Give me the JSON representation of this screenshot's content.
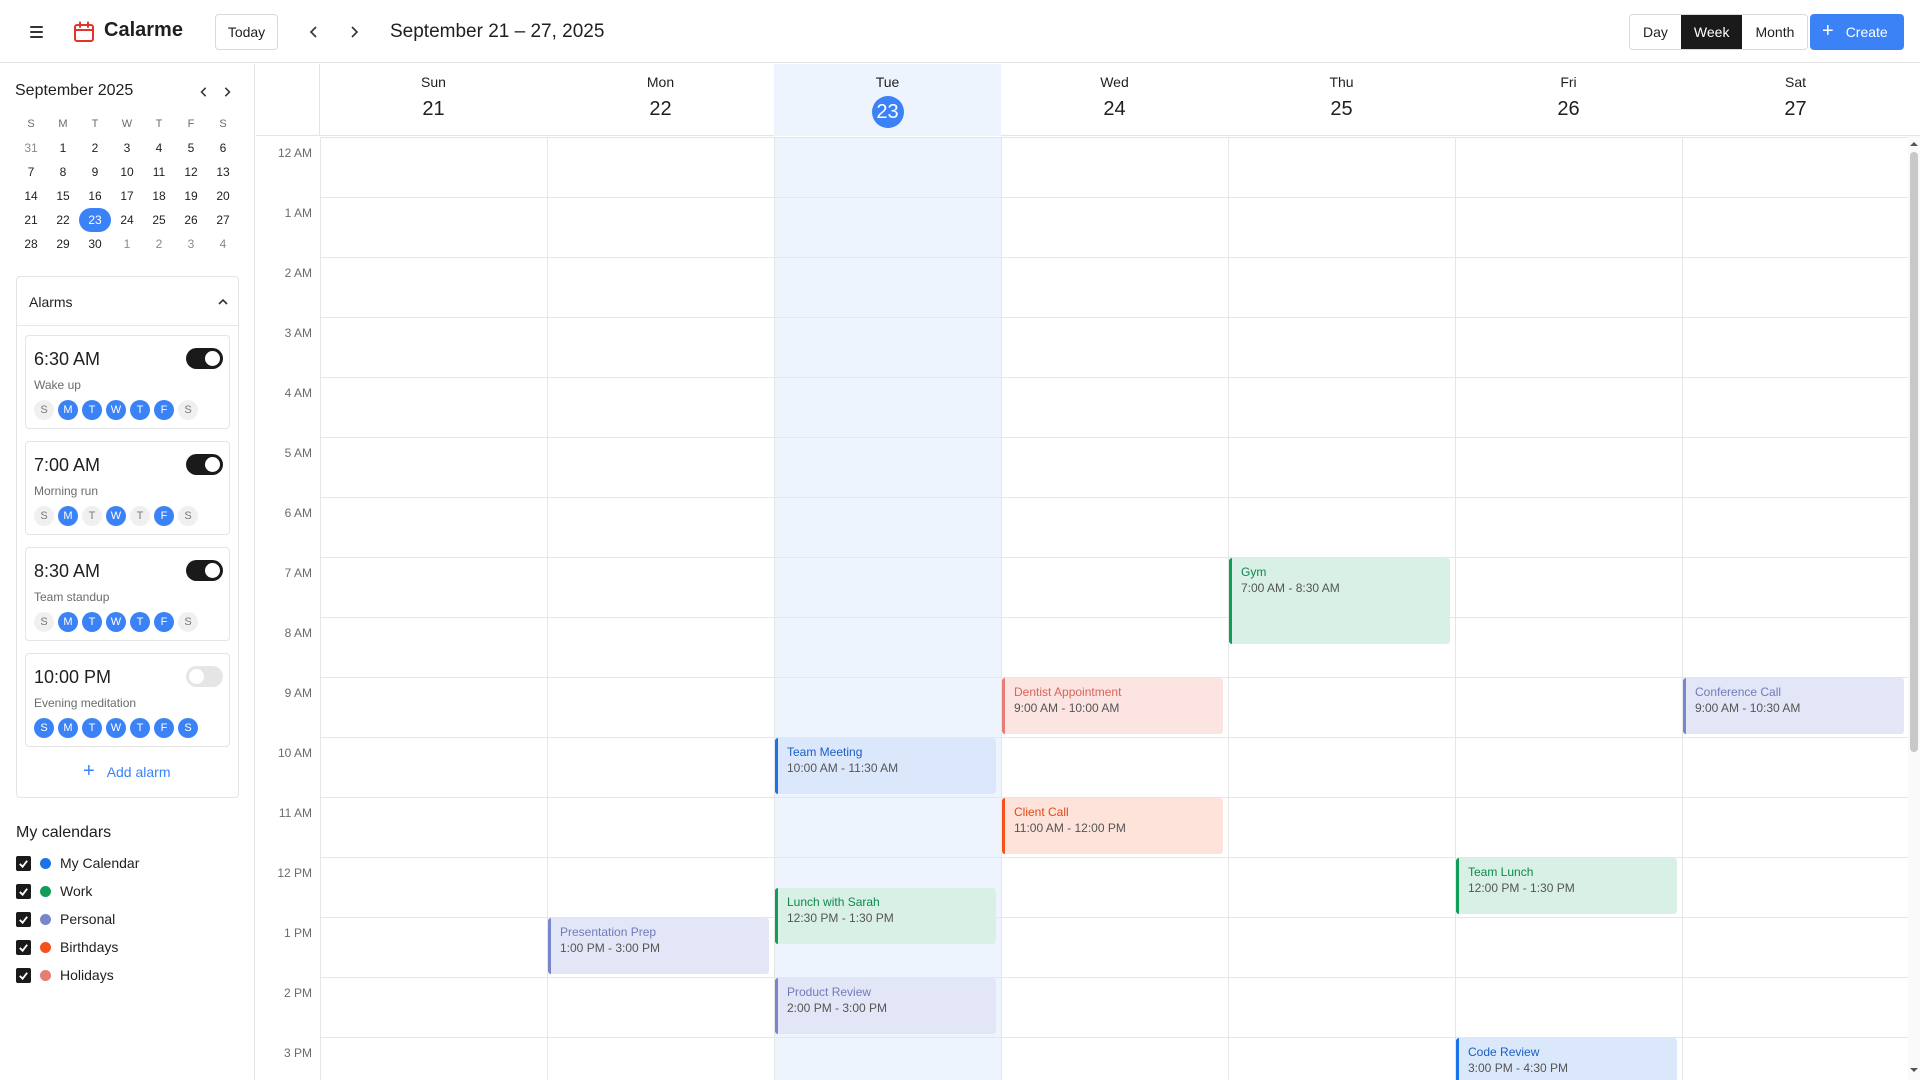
{
  "header": {
    "app_title": "Calarme",
    "today_label": "Today",
    "date_range": "September 21 – 27, 2025",
    "views": [
      "Day",
      "Week",
      "Month"
    ],
    "active_view": "Week",
    "create_label": "Create"
  },
  "mini_calendar": {
    "title": "September 2025",
    "weekdays": [
      "S",
      "M",
      "T",
      "W",
      "T",
      "F",
      "S"
    ],
    "weeks": [
      [
        "31",
        "1",
        "2",
        "3",
        "4",
        "5",
        "6"
      ],
      [
        "7",
        "8",
        "9",
        "10",
        "11",
        "12",
        "13"
      ],
      [
        "14",
        "15",
        "16",
        "17",
        "18",
        "19",
        "20"
      ],
      [
        "21",
        "22",
        "23",
        "24",
        "25",
        "26",
        "27"
      ],
      [
        "28",
        "29",
        "30",
        "1",
        "2",
        "3",
        "4"
      ]
    ],
    "selected": "23"
  },
  "alarms": {
    "title": "Alarms",
    "add_label": "Add alarm",
    "day_letters": [
      "S",
      "M",
      "T",
      "W",
      "T",
      "F",
      "S"
    ],
    "items": [
      {
        "time": "6:30 AM",
        "label": "Wake up",
        "enabled": true,
        "days": [
          false,
          true,
          true,
          true,
          true,
          true,
          false
        ]
      },
      {
        "time": "7:00 AM",
        "label": "Morning run",
        "enabled": true,
        "days": [
          false,
          true,
          false,
          true,
          false,
          true,
          false
        ]
      },
      {
        "time": "8:30 AM",
        "label": "Team standup",
        "enabled": true,
        "days": [
          false,
          true,
          true,
          true,
          true,
          true,
          false
        ]
      },
      {
        "time": "10:00 PM",
        "label": "Evening meditation",
        "enabled": false,
        "days": [
          true,
          true,
          true,
          true,
          true,
          true,
          true
        ]
      }
    ]
  },
  "calendars": {
    "title": "My calendars",
    "items": [
      {
        "name": "My Calendar",
        "color": "#1a73e8",
        "checked": true
      },
      {
        "name": "Work",
        "color": "#0f9d58",
        "checked": true
      },
      {
        "name": "Personal",
        "color": "#7986cb",
        "checked": true
      },
      {
        "name": "Birthdays",
        "color": "#f4511e",
        "checked": true
      },
      {
        "name": "Holidays",
        "color": "#e67c73",
        "checked": true
      }
    ]
  },
  "week": {
    "days": [
      {
        "dow": "Sun",
        "num": "21",
        "today": false
      },
      {
        "dow": "Mon",
        "num": "22",
        "today": false
      },
      {
        "dow": "Tue",
        "num": "23",
        "today": true
      },
      {
        "dow": "Wed",
        "num": "24",
        "today": false
      },
      {
        "dow": "Thu",
        "num": "25",
        "today": false
      },
      {
        "dow": "Fri",
        "num": "26",
        "today": false
      },
      {
        "dow": "Sat",
        "num": "27",
        "today": false
      }
    ],
    "hours": [
      "12 AM",
      "1 AM",
      "2 AM",
      "3 AM",
      "4 AM",
      "5 AM",
      "6 AM",
      "7 AM",
      "8 AM",
      "9 AM",
      "10 AM",
      "11 AM",
      "12 PM",
      "1 PM",
      "2 PM",
      "3 PM"
    ]
  },
  "events": [
    {
      "title": "Gym",
      "time": "7:00 AM - 8:30 AM",
      "day": 4,
      "start": 7,
      "end": 8.5,
      "calendar": "Work"
    },
    {
      "title": "Dentist Appointment",
      "time": "9:00 AM - 10:00 AM",
      "day": 3,
      "start": 9,
      "end": 10,
      "calendar": "Holidays"
    },
    {
      "title": "Conference Call",
      "time": "9:00 AM - 10:30 AM",
      "day": 6,
      "start": 9,
      "end": 10,
      "calendar": "Personal"
    },
    {
      "title": "Team Meeting",
      "time": "10:00 AM - 11:30 AM",
      "day": 2,
      "start": 10,
      "end": 11,
      "calendar": "My Calendar"
    },
    {
      "title": "Client Call",
      "time": "11:00 AM - 12:00 PM",
      "day": 3,
      "start": 11,
      "end": 12,
      "calendar": "Birthdays"
    },
    {
      "title": "Team Lunch",
      "time": "12:00 PM - 1:30 PM",
      "day": 5,
      "start": 12,
      "end": 13,
      "calendar": "Work"
    },
    {
      "title": "Lunch with Sarah",
      "time": "12:30 PM - 1:30 PM",
      "day": 2,
      "start": 12.5,
      "end": 13.5,
      "calendar": "Work"
    },
    {
      "title": "Presentation Prep",
      "time": "1:00 PM - 3:00 PM",
      "day": 1,
      "start": 13,
      "end": 14,
      "calendar": "Personal"
    },
    {
      "title": "Product Review",
      "time": "2:00 PM - 3:00 PM",
      "day": 2,
      "start": 14,
      "end": 15,
      "calendar": "Personal"
    },
    {
      "title": "Code Review",
      "time": "3:00 PM - 4:30 PM",
      "day": 5,
      "start": 15,
      "end": 16.5,
      "calendar": "My Calendar"
    }
  ]
}
